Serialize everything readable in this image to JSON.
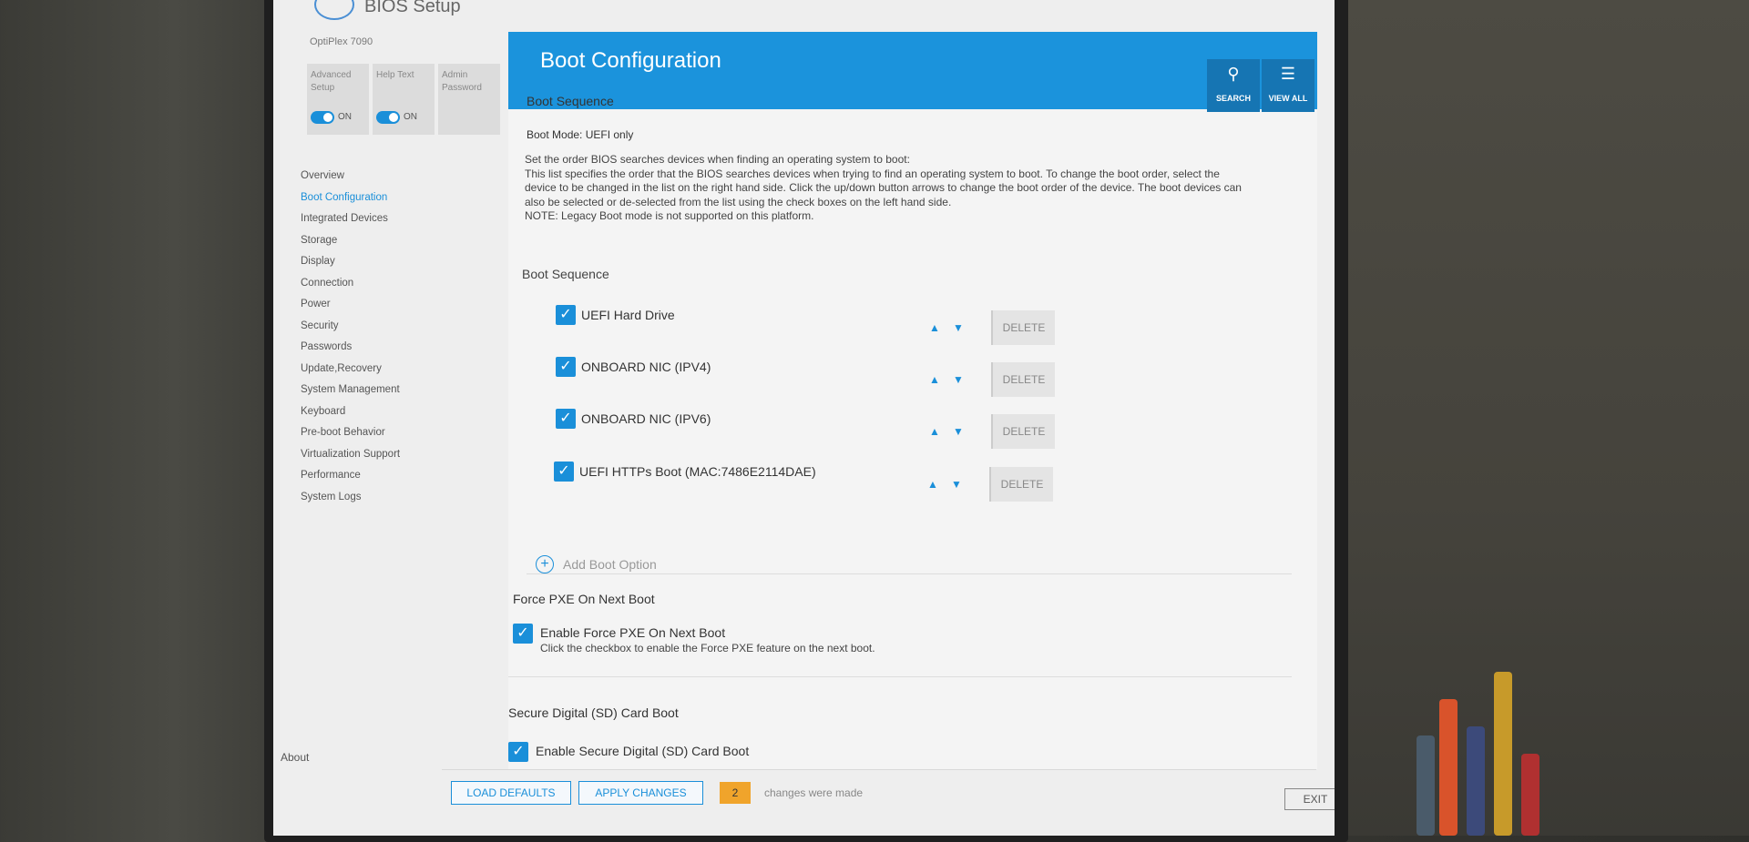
{
  "window": {
    "title": "BIOS Setup",
    "model": "OptiPlex 7090"
  },
  "quick_settings": [
    {
      "label": "Advanced Setup",
      "state": "ON"
    },
    {
      "label": "Help Text",
      "state": "ON"
    },
    {
      "label": "Admin Password",
      "state": ""
    }
  ],
  "sidebar": {
    "items": [
      {
        "label": "Overview"
      },
      {
        "label": "Boot Configuration",
        "active": true
      },
      {
        "label": "Integrated Devices"
      },
      {
        "label": "Storage"
      },
      {
        "label": "Display"
      },
      {
        "label": "Connection"
      },
      {
        "label": "Power"
      },
      {
        "label": "Security"
      },
      {
        "label": "Passwords"
      },
      {
        "label": "Update,Recovery"
      },
      {
        "label": "System Management"
      },
      {
        "label": "Keyboard"
      },
      {
        "label": "Pre-boot Behavior"
      },
      {
        "label": "Virtualization Support"
      },
      {
        "label": "Performance"
      },
      {
        "label": "System Logs"
      }
    ],
    "about": "About"
  },
  "header": {
    "title": "Boot Configuration",
    "search_label": "SEARCH",
    "viewall_label": "VIEW ALL"
  },
  "boot_sequence": {
    "section_title": "Boot Sequence",
    "boot_mode": "Boot Mode: UEFI only",
    "description": "Set the order BIOS searches devices when finding an operating system to boot:\nThis list specifies the order that the BIOS searches devices when trying to find an operating system to boot.  To change the boot order, select the device to be changed in the list on the right hand side.  Click the up/down button arrows to change the boot order of the device.  The boot devices can also be selected or de-selected from the list using the check boxes on the left hand side.\nNOTE: Legacy Boot mode is not supported on this platform.",
    "list_title": "Boot Sequence",
    "devices": [
      {
        "name": "UEFI Hard Drive",
        "checked": true
      },
      {
        "name": "ONBOARD NIC (IPV4)",
        "checked": true
      },
      {
        "name": "ONBOARD NIC (IPV6)",
        "checked": true
      },
      {
        "name": "UEFI HTTPs Boot (MAC:7486E2114DAE)",
        "checked": true
      }
    ],
    "delete_label": "DELETE",
    "add_label": "Add Boot Option"
  },
  "force_pxe": {
    "title": "Force PXE On Next Boot",
    "option_label": "Enable Force PXE On Next Boot",
    "help": "Click the checkbox to enable the Force PXE feature on the next boot.",
    "checked": true
  },
  "sd_boot": {
    "title": "Secure Digital (SD) Card Boot",
    "option_label": "Enable Secure Digital (SD) Card Boot"
  },
  "footer": {
    "load_defaults": "LOAD DEFAULTS",
    "apply_changes": "APPLY CHANGES",
    "changes_count": "2",
    "changes_text": "changes were made",
    "exit": "EXIT"
  },
  "colors": {
    "accent": "#1a8fd9",
    "banner": "#1b93dc",
    "badge": "#f0a42b"
  },
  "icons": [
    "search-icon",
    "view-all-icon",
    "checkbox-icon",
    "arrow-up-icon",
    "arrow-down-icon",
    "plus-circle-icon"
  ]
}
